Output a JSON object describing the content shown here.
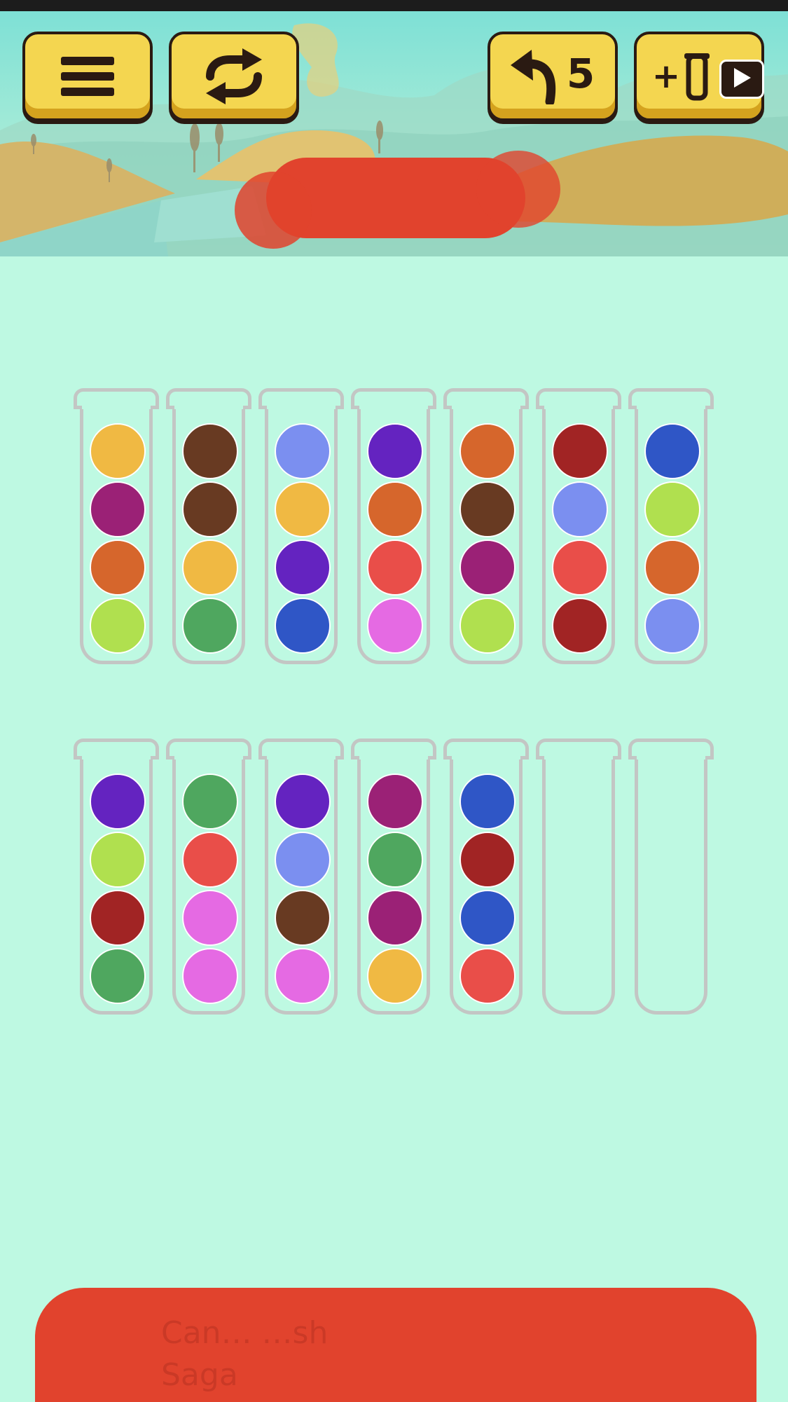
{
  "toolbar": {
    "menu_icon": "hamburger-menu-icon",
    "restart_icon": "restart-arrows-icon",
    "undo_icon": "undo-arrow-icon",
    "undo_count": "5",
    "add_tube_icon": "add-tube-icon",
    "add_tube_prefix": "+",
    "watch_ad_icon": "play-video-icon"
  },
  "level_banner": {
    "redacted": true
  },
  "ad_banner": {
    "text": "Can… …sh\nSaga",
    "redacted": true
  },
  "colors": {
    "yellow": "#f0b943",
    "purple": "#9b2176",
    "orange": "#d6662c",
    "lime": "#b0e04f",
    "brown": "#683a22",
    "green": "#4fa75f",
    "periwinkle": "#7b8ff0",
    "violet": "#6423c0",
    "blue": "#2f56c6",
    "red": "#e94e49",
    "pink": "#e56ae3",
    "maroon": "#a12424"
  },
  "tubes": [
    [
      "yellow",
      "purple",
      "orange",
      "lime"
    ],
    [
      "brown",
      "brown",
      "yellow",
      "green"
    ],
    [
      "periwinkle",
      "yellow",
      "violet",
      "blue"
    ],
    [
      "violet",
      "orange",
      "red",
      "pink"
    ],
    [
      "orange",
      "brown",
      "purple",
      "lime"
    ],
    [
      "maroon",
      "periwinkle",
      "red",
      "maroon"
    ],
    [
      "blue",
      "lime",
      "orange",
      "periwinkle"
    ],
    [
      "violet",
      "lime",
      "maroon",
      "green"
    ],
    [
      "green",
      "red",
      "pink",
      "pink"
    ],
    [
      "violet",
      "periwinkle",
      "brown",
      "pink"
    ],
    [
      "purple",
      "green",
      "purple",
      "yellow"
    ],
    [
      "blue",
      "maroon",
      "blue",
      "red"
    ],
    [],
    []
  ]
}
